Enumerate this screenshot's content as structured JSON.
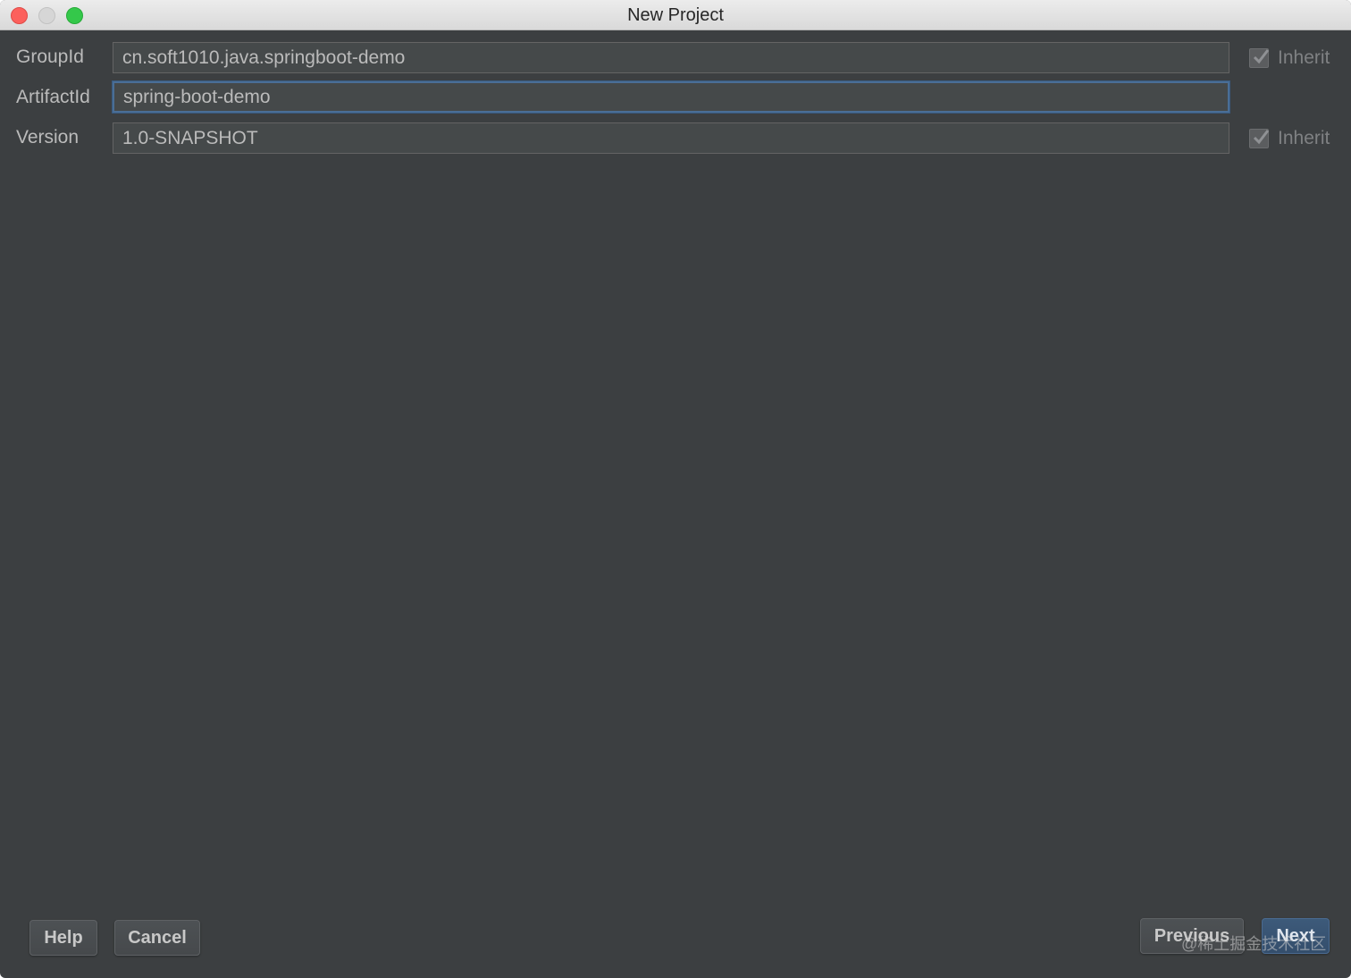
{
  "window": {
    "title": "New Project"
  },
  "form": {
    "group_id": {
      "label": "GroupId",
      "value": "cn.soft1010.java.springboot-demo",
      "inherit_label": "Inherit",
      "inherit_checked": true
    },
    "artifact_id": {
      "label": "ArtifactId",
      "value": "spring-boot-demo"
    },
    "version": {
      "label": "Version",
      "value": "1.0-SNAPSHOT",
      "inherit_label": "Inherit",
      "inherit_checked": true
    }
  },
  "footer": {
    "help_label": "Help",
    "cancel_label": "Cancel",
    "previous_label": "Previous",
    "next_label": "Next"
  },
  "watermark": "@稀土掘金技术社区",
  "colors": {
    "background": "#3c3f41",
    "field_background": "#45494a",
    "focus_border": "#4a6e96",
    "text": "#bbbbbb"
  }
}
